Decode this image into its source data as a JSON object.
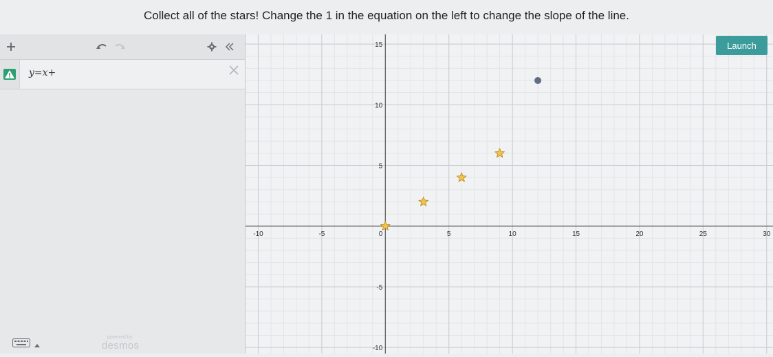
{
  "instructions": "Collect all of the stars! Change the 1 in the equation on the left to change the slope of the line.",
  "toolbar": {
    "add_icon": "plus-icon",
    "undo_icon": "undo-icon",
    "redo_icon": "redo-icon",
    "settings_icon": "gear-icon",
    "collapse_icon": "double-chevron-left-icon"
  },
  "expressions": [
    {
      "index": 1,
      "latex": "y=x+",
      "status_icon": "warning-icon",
      "status_color": "#2e9f74"
    }
  ],
  "keyboard": {
    "icon": "keyboard-icon",
    "toggle_icon": "caret-up-icon"
  },
  "branding": {
    "powered_by": "powered by",
    "name": "desmos"
  },
  "launch_button": {
    "label": "Launch",
    "color": "#3b9c9b"
  },
  "chart_data": {
    "type": "scatter",
    "xlim": [
      -11,
      30.5
    ],
    "ylim": [
      -10.5,
      15.8
    ],
    "x_ticks": [
      -10,
      -5,
      5,
      10,
      15,
      20,
      25,
      30
    ],
    "x_tick_labels": [
      "-10",
      "-5",
      "5",
      "10",
      "15",
      "20",
      "25",
      "30"
    ],
    "y_ticks": [
      -10,
      -5,
      5,
      10,
      15
    ],
    "y_tick_labels": [
      "-10",
      "-5",
      "5",
      "10",
      "15"
    ],
    "origin_label": "0",
    "major_grid_step": 5,
    "minor_grid_step": 1,
    "grid": true,
    "stars": [
      {
        "x": 0,
        "y": 0
      },
      {
        "x": 3,
        "y": 2
      },
      {
        "x": 6,
        "y": 4
      },
      {
        "x": 9,
        "y": 6
      }
    ],
    "star_color": "#f1c24f",
    "point": {
      "x": 12,
      "y": 12
    },
    "point_color": "#5f6e85"
  }
}
